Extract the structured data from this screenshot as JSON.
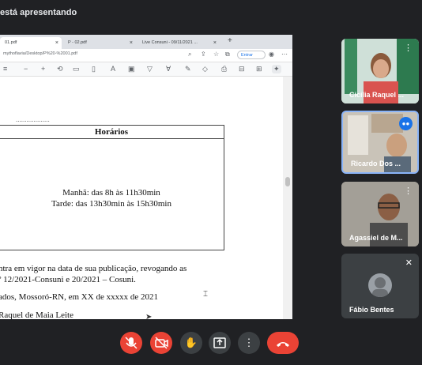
{
  "meet": {
    "presenting_label": "está apresentando",
    "participants": [
      {
        "name": "Cicília Raquel ..."
      },
      {
        "name": "Ricardo Dos ..."
      },
      {
        "name": "Agassiel de M..."
      },
      {
        "name": "Fábio Bentes"
      }
    ],
    "controls": {
      "mic": "mic-off-icon",
      "cam": "camera-off-icon",
      "hand": "raise-hand-icon",
      "present": "present-icon",
      "more": "more-vert-icon",
      "end": "end-call-icon"
    }
  },
  "browser": {
    "tabs": [
      {
        "label": "01.pdf"
      },
      {
        "label": "P - 02.pdf"
      },
      {
        "label": "Live Consuni - 09/11/2021 ..."
      }
    ],
    "new_tab": "+",
    "url": "mythoflavia/Desktop/P%20-%2001.pdf",
    "signin_label": "Entrar"
  },
  "document": {
    "cut_heading": "...................",
    "table_header": "Horários",
    "schedule_morning": "Manhã: das 8h às 11h30min",
    "schedule_afternoon": "Tarde: das 13h30min às 15h30min",
    "para1_line1": "ntra em vigor na data de sua publicação, revogando as",
    "para1_line2": "º 12/2021-Consuni e 20/2021 – Cosuni.",
    "place_date": "ados, Mossoró-RN, em XX de xxxxx de 2021",
    "signatory": "Raquel de Maia Leite"
  },
  "colors": {
    "accent_red": "#ea4335",
    "active_border": "#8ab4f8",
    "speaking": "#1a73e8"
  }
}
